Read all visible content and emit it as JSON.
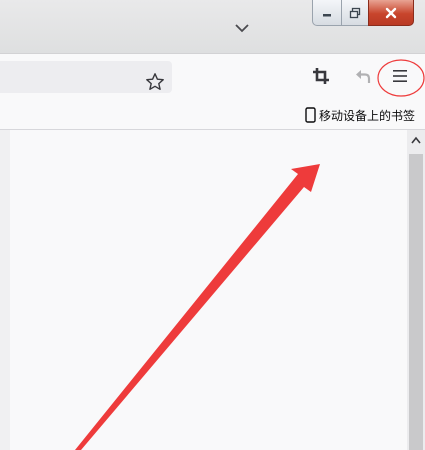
{
  "window": {
    "controls": {
      "minimize_icon": "minimize-icon",
      "maximize_icon": "restore-icon",
      "close_icon": "close-x-icon",
      "close_color": "#c8452c"
    }
  },
  "tabstrip": {
    "list_all_tabs_icon": "chevron-down-icon"
  },
  "toolbar": {
    "bookmark_icon": "star-outline-icon",
    "screenshot_icon": "crop-icon",
    "undo_icon": "undo-arrow-icon",
    "menu_icon": "hamburger-menu-icon"
  },
  "bookmarks_bar": {
    "mobile_bookmarks_label": "移动设备上的书签",
    "mobile_icon": "mobile-device-icon"
  },
  "annotations": {
    "color": "#ee3b3b",
    "menu_highlight_shape": "ellipse",
    "arrow_target": "menu-button"
  }
}
